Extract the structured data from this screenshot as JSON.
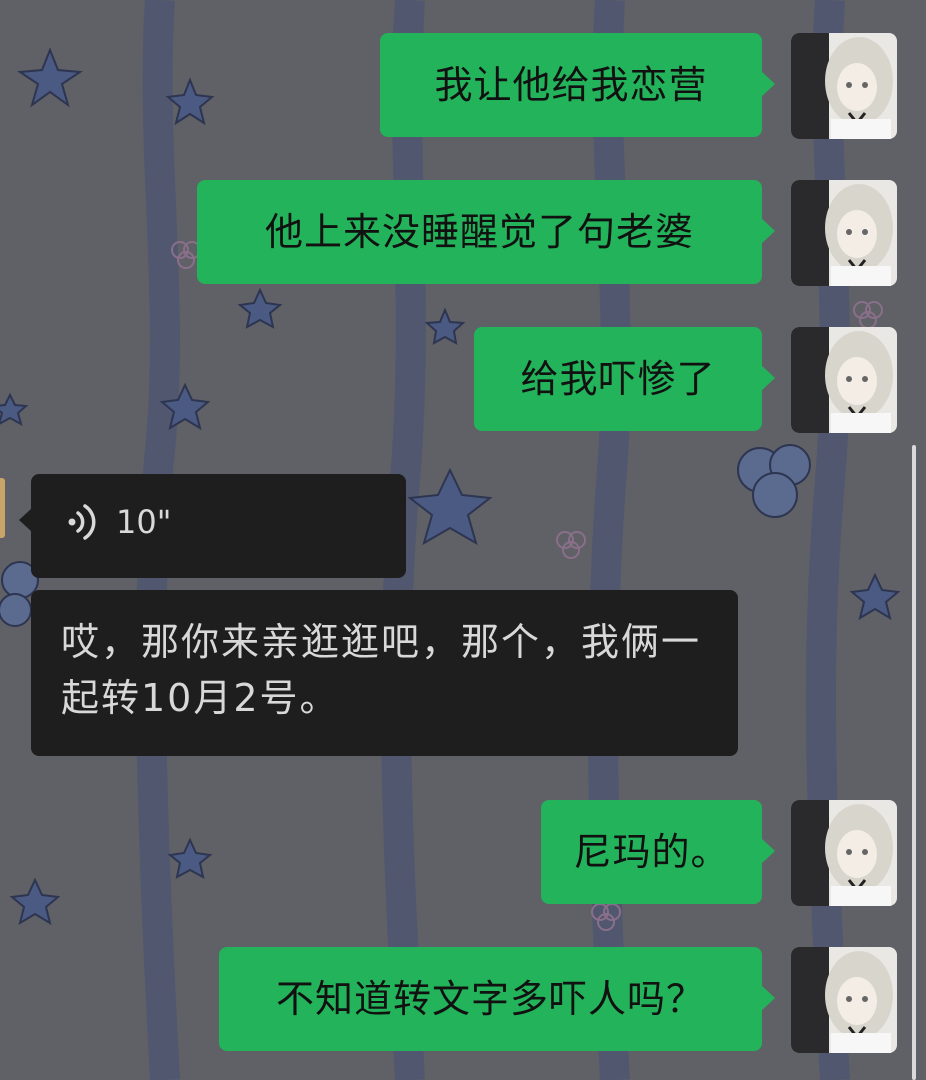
{
  "chat": {
    "messages": [
      {
        "side": "out",
        "text": "我让他给我恋营"
      },
      {
        "side": "out",
        "text": "他上来没睡醒觉了句老婆"
      },
      {
        "side": "out",
        "text": "给我吓惨了"
      },
      {
        "side": "in",
        "type": "voice",
        "duration": "10\"",
        "transcript": "哎，那你来亲逛逛吧，那个，我俩一起转10月2号。"
      },
      {
        "side": "out",
        "text": "尼玛的。"
      },
      {
        "side": "out",
        "text": "不知道转文字多吓人吗？"
      }
    ]
  },
  "colors": {
    "background": "#5f6167",
    "outgoing_bubble": "#23b35a",
    "incoming_bubble": "#1e1e1f"
  },
  "icons": {
    "voice": "voice-wave-icon",
    "avatar": "avatar-anime-girl"
  }
}
